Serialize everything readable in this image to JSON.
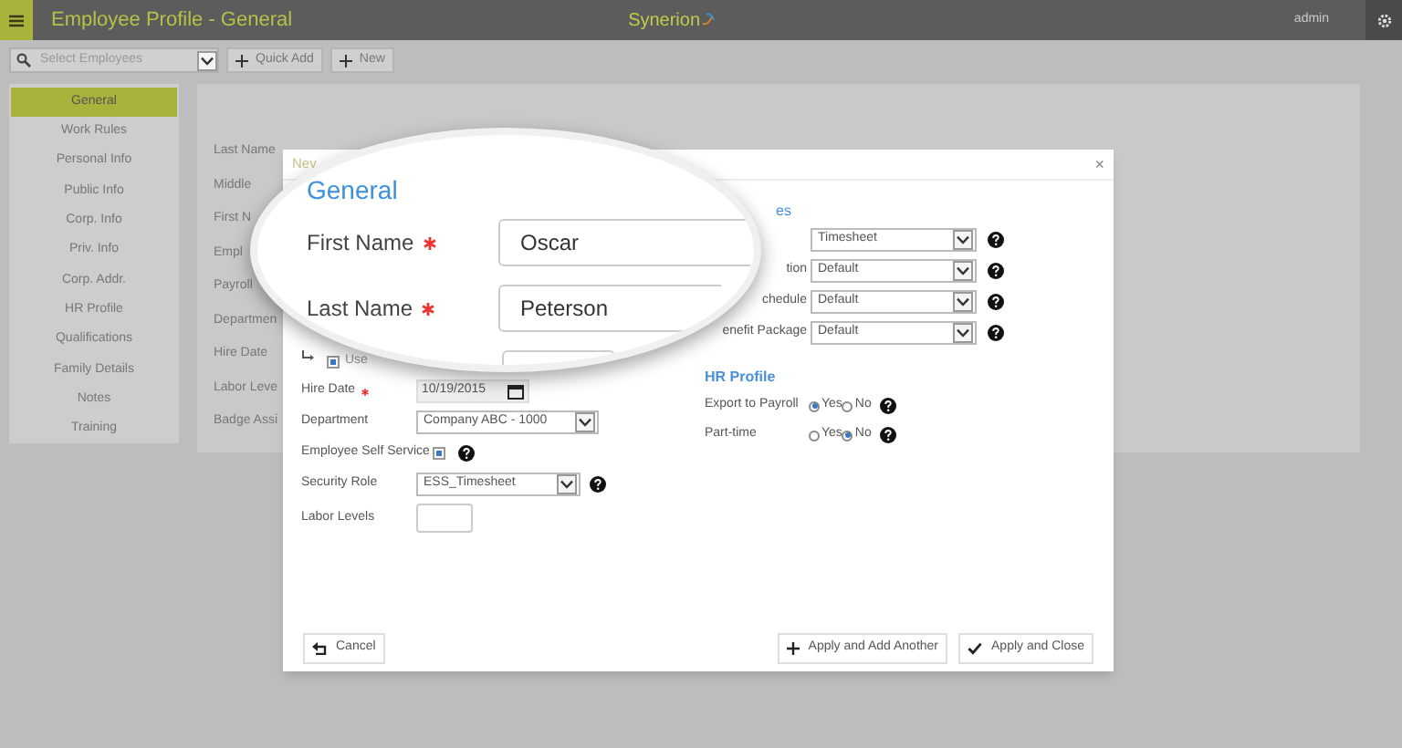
{
  "top_bar": {
    "title": "Employee Profile - General",
    "logo": "Synerion",
    "user": "admin"
  },
  "toolbar": {
    "search": {
      "placeholder": "Select Employees"
    },
    "buttons": [
      "Quick Add",
      "New"
    ]
  },
  "sidebar": {
    "items": [
      {
        "label": "General",
        "selected": true
      },
      {
        "label": "Work Rules",
        "selected": false
      },
      {
        "label": "Personal Info",
        "selected": false
      },
      {
        "label": "Public Info",
        "selected": false
      },
      {
        "label": "Corp. Info",
        "selected": false
      },
      {
        "label": "Priv. Info",
        "selected": false
      },
      {
        "label": "Corp. Addr.",
        "selected": false
      },
      {
        "label": "HR Profile",
        "selected": false
      },
      {
        "label": "Qualifications",
        "selected": false
      },
      {
        "label": "Family Details",
        "selected": false
      },
      {
        "label": "Notes",
        "selected": false
      },
      {
        "label": "Training",
        "selected": false
      }
    ]
  },
  "background_form": {
    "labels": [
      "Last Name",
      "Middle",
      "First N",
      "Empl",
      "Payroll",
      "Departmen",
      "Hire Date",
      "Labor Leve",
      "Badge Assi"
    ]
  },
  "dialog": {
    "title": "Nev",
    "close": "×",
    "use_as": {
      "label": "Use",
      "checked": true
    },
    "left_fields": [
      {
        "kind": "date",
        "label": "Hire Date",
        "required": true,
        "value": "10/19/2015"
      },
      {
        "kind": "select",
        "label": "Department",
        "value": "Company ABC - 1000"
      },
      {
        "kind": "checkbox",
        "label": "Employee Self Service",
        "checked": true,
        "help": true
      },
      {
        "kind": "select",
        "label": "Security Role",
        "value": "ESS_Timesheet",
        "help": true
      },
      {
        "kind": "input",
        "label": "Labor Levels"
      }
    ],
    "right_section": {
      "title": "es",
      "rows": [
        {
          "value": "Timesheet"
        },
        {
          "label": "tion",
          "value": "Default"
        },
        {
          "label": "chedule",
          "value": "Default"
        },
        {
          "label": "enefit Package",
          "value": "Default"
        }
      ]
    },
    "hr_profile": {
      "title": "HR Profile",
      "rows": [
        {
          "label": "Export to Payroll",
          "options": [
            {
              "label": "Yes",
              "selected": true
            },
            {
              "label": "No",
              "selected": false
            }
          ]
        },
        {
          "label": "Part-time",
          "options": [
            {
              "label": "Yes",
              "selected": false
            },
            {
              "label": "No",
              "selected": true
            }
          ]
        }
      ]
    },
    "cancel": "Cancel",
    "buttons": [
      {
        "kind": "add",
        "label": "Apply and Add Another"
      },
      {
        "kind": "check",
        "label": "Apply and Close"
      }
    ]
  },
  "magnifier": {
    "title": "General",
    "fields": [
      {
        "label": "First Name",
        "required": true,
        "value": "Oscar"
      },
      {
        "label": "Last Name",
        "required": true,
        "value": "Peterson"
      }
    ]
  }
}
